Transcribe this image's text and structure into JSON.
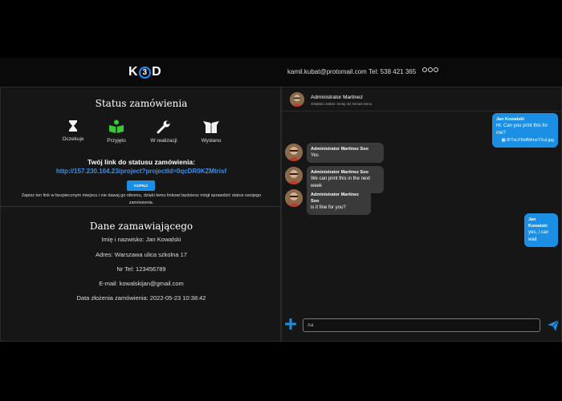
{
  "header": {
    "logo_left": "K",
    "logo_mid": "3",
    "logo_right": "D",
    "email": "kamil.kubat@protomail.com",
    "phone": "Tel: 538 421 365",
    "social_icons": [
      "facebook-icon",
      "instagram-icon",
      "other-social-icon"
    ]
  },
  "order_status": {
    "title": "Status zamówienia",
    "steps": [
      {
        "label": "Oczekuje",
        "icon": "hourglass-icon",
        "active": false
      },
      {
        "label": "Przyjęto",
        "icon": "book-icon",
        "active": true
      },
      {
        "label": "W realizacji",
        "icon": "wrench-icon",
        "active": false
      },
      {
        "label": "Wysłano",
        "icon": "box-icon",
        "active": false
      }
    ],
    "link_heading": "Twój link do statusu zamówienia:",
    "link_url": "http://157.230.104.23/project?projectId=0qcDR0KZMtrisf",
    "copy_label": "KOPIUJ",
    "note_line1": "Zapisz ten link w bezpiecznym miejscu i nie dawaj go nikomu, dzięki temu linkowi będziesz mógł sprawdzić status swojego",
    "note_line2": "zamówienia."
  },
  "customer": {
    "title": "Dane zamawiającego",
    "name": "Imię i nazwisko: Jan Kowalski",
    "address": "Adres: Warszawa ulica szkolna 17",
    "phone": "Nr Tel: 123456789",
    "email": "E-mail: kowalskijan@gmail.com",
    "order_date": "Data złożenia zamówienia: 2022-05-23 10:38:42"
  },
  "chat": {
    "contact_name": "Administrator Martinez",
    "contact_status": "Ostatnio online: mniej niż minute temu",
    "messages": [
      {
        "from": "Jan Kowalski",
        "text": "Hi. Can you print this for me?",
        "file": "tFTxLFNdlWmeTXul.jpg",
        "outgoing": true
      },
      {
        "from": "Administrator Martinez Soo",
        "text": "Yes",
        "outgoing": false
      },
      {
        "from": "Administrator Martinez Soo",
        "text": "We can print this in the next week",
        "outgoing": false
      },
      {
        "from": "Administrator Martinez Soo",
        "text": "is it fine for you?",
        "outgoing": false
      },
      {
        "from": "Jan Kowalski",
        "text": "yes, i can wait",
        "outgoing": true
      }
    ],
    "input_placeholder": "Aa"
  },
  "colors": {
    "accent": "#1a8fe3",
    "active_step": "#3cc63c",
    "link": "#3d8fe8",
    "panel": "#161616"
  }
}
